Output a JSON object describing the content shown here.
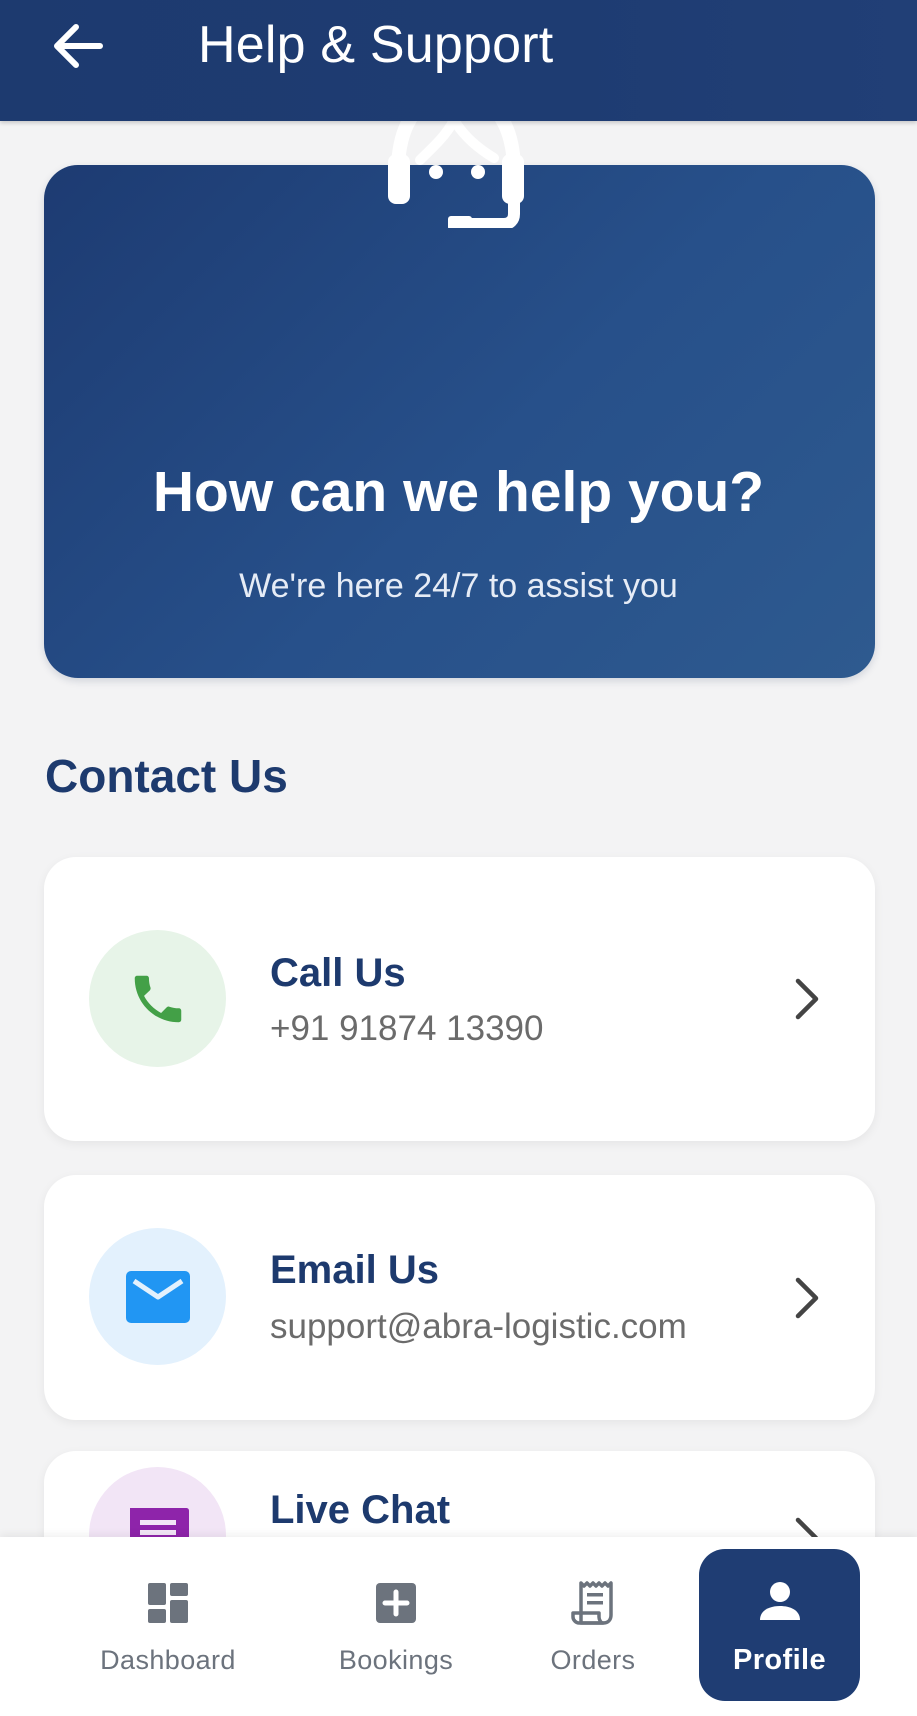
{
  "appbar": {
    "title": "Help & Support",
    "back_icon": "arrow-left-icon"
  },
  "hero": {
    "icon": "support-agent-icon",
    "title": "How can we help you?",
    "subtitle": "We're here 24/7 to assist you"
  },
  "contact": {
    "section_title": "Contact Us",
    "items": [
      {
        "title": "Call Us",
        "subtitle": "+91 91874 13390",
        "icon": "phone-icon",
        "color": "#43a047"
      },
      {
        "title": "Email Us",
        "subtitle": "support@abra-logistic.com",
        "icon": "mail-icon",
        "color": "#2196f3"
      },
      {
        "title": "Live Chat",
        "subtitle": "",
        "icon": "chat-icon",
        "color": "#8e24aa"
      }
    ]
  },
  "nav": {
    "items": [
      {
        "label": "Dashboard",
        "icon": "dashboard-icon",
        "active": false
      },
      {
        "label": "Bookings",
        "icon": "add-box-icon",
        "active": false
      },
      {
        "label": "Orders",
        "icon": "receipt-icon",
        "active": false
      },
      {
        "label": "Profile",
        "icon": "person-icon",
        "active": true
      }
    ]
  },
  "colors": {
    "primary": "#1e3c72",
    "background": "#f3f3f4",
    "text_primary": "#1d3a6e",
    "text_secondary": "#6b6b6b"
  }
}
